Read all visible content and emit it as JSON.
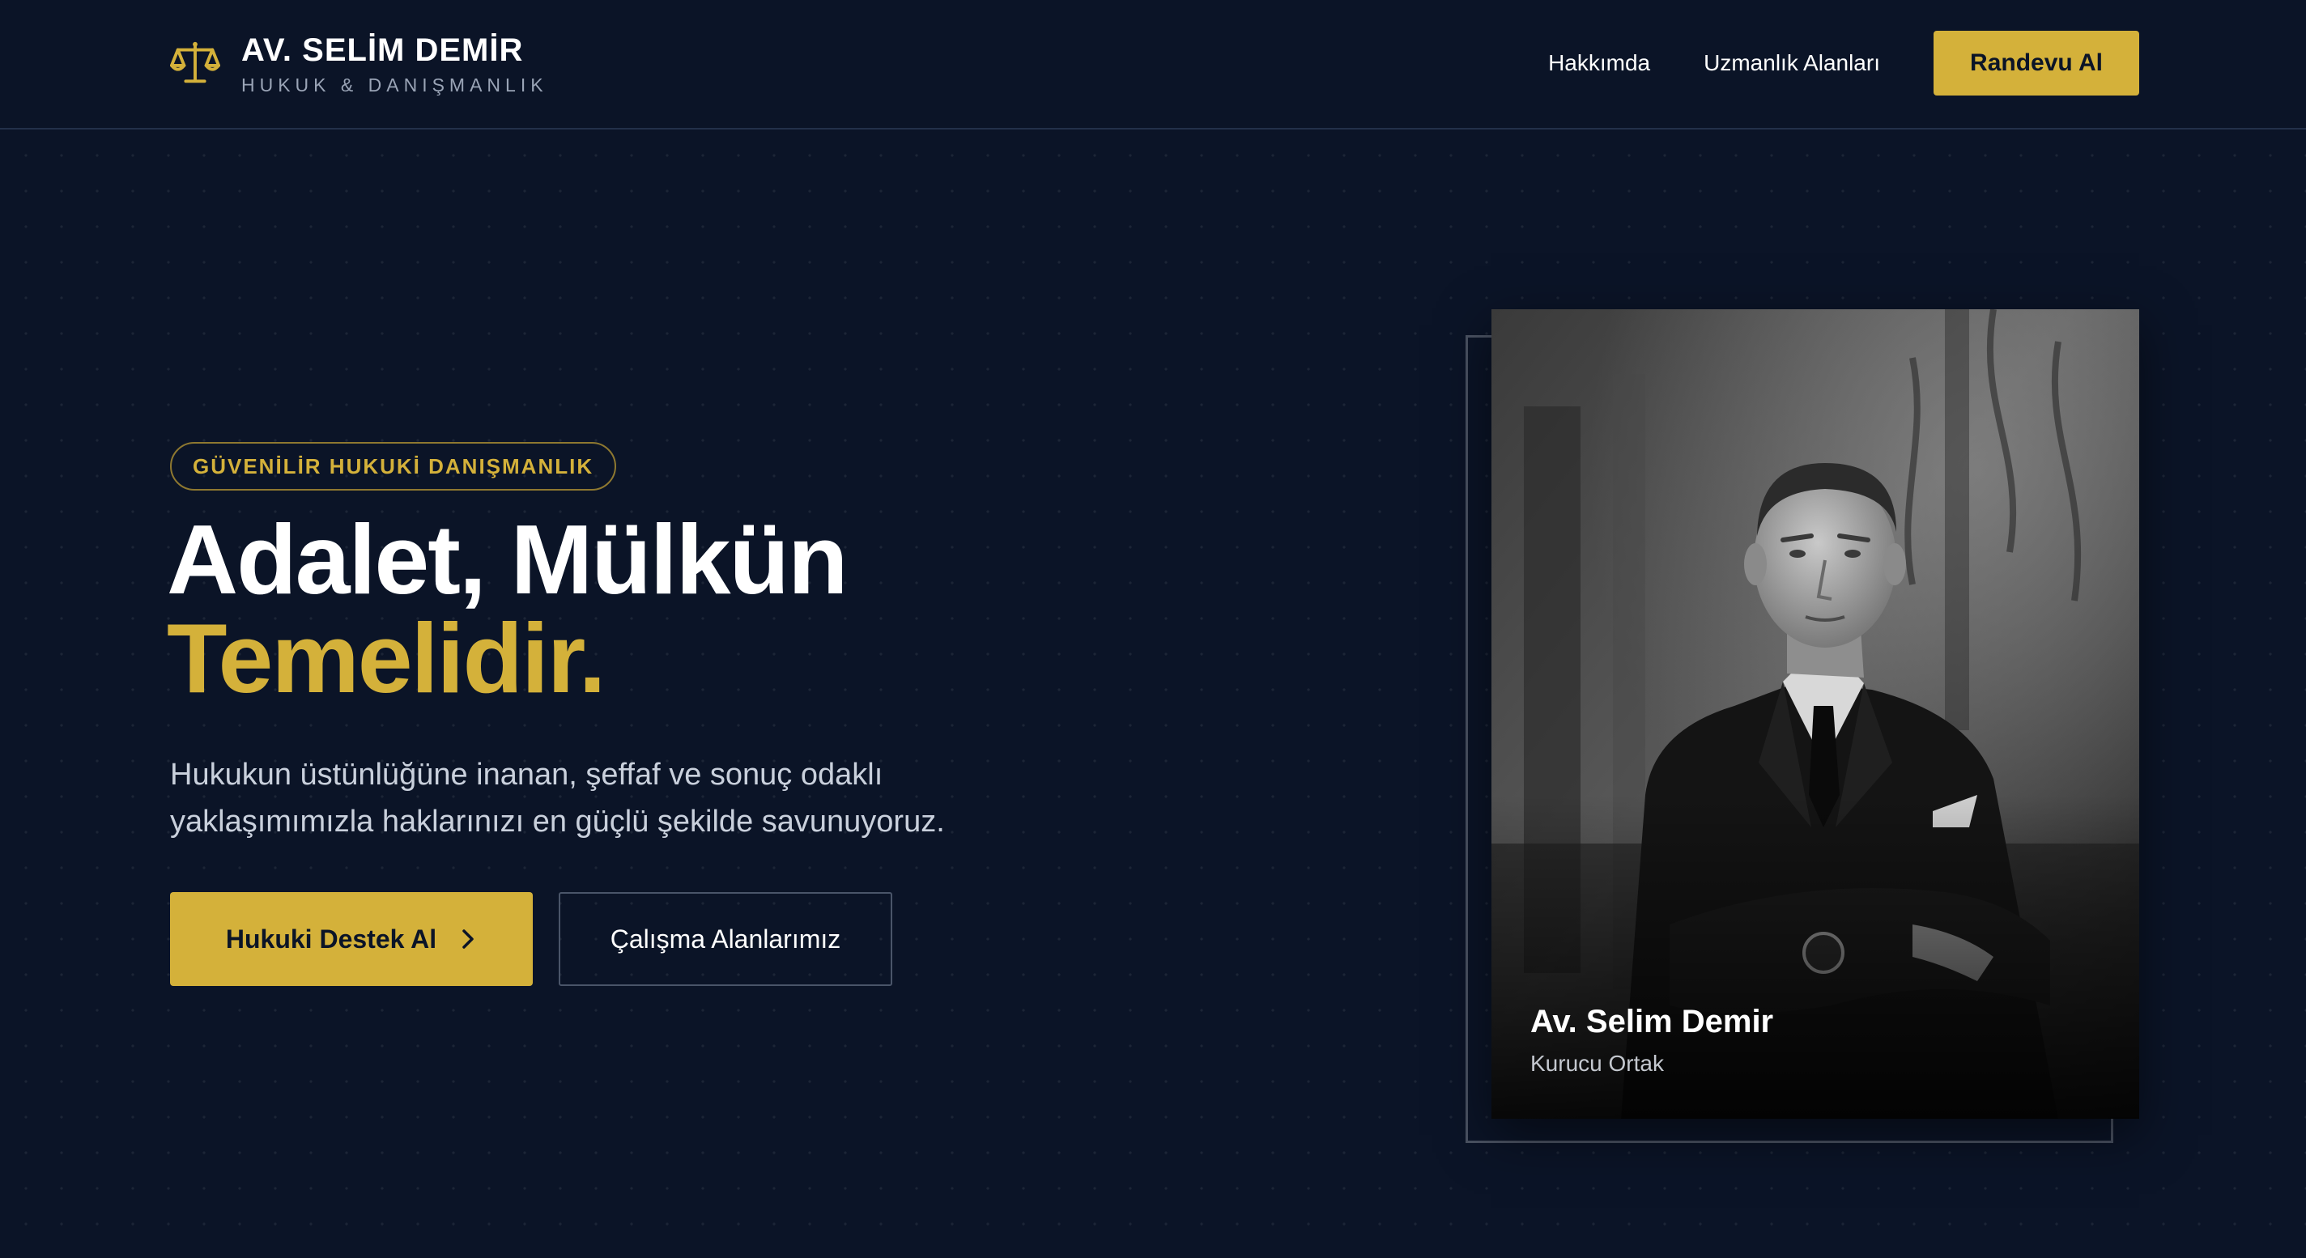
{
  "brand": {
    "name": "AV. SELİM DEMİR",
    "subtitle": "HUKUK & DANIŞMANLIK",
    "icon": "scales-of-justice-icon"
  },
  "nav": {
    "links": [
      "Hakkımda",
      "Uzmanlık Alanları"
    ],
    "cta": "Randevu Al"
  },
  "hero": {
    "badge": "GÜVENİLİR HUKUKİ DANIŞMANLIK",
    "headline_line1": "Adalet, Mülkün",
    "headline_line2": "Temelidir.",
    "lead": "Hukukun üstünlüğüne inanan, şeffaf ve sonuç odaklı yaklaşımımızla haklarınızı en güçlü şekilde savunuyoruz.",
    "primary_button": "Hukuki Destek Al",
    "secondary_button": "Çalışma Alanlarımız"
  },
  "profile": {
    "name": "Av. Selim Demir",
    "role": "Kurucu Ortak"
  },
  "colors": {
    "background": "#0b1427",
    "accent": "#d4b13a",
    "text": "#ffffff"
  }
}
